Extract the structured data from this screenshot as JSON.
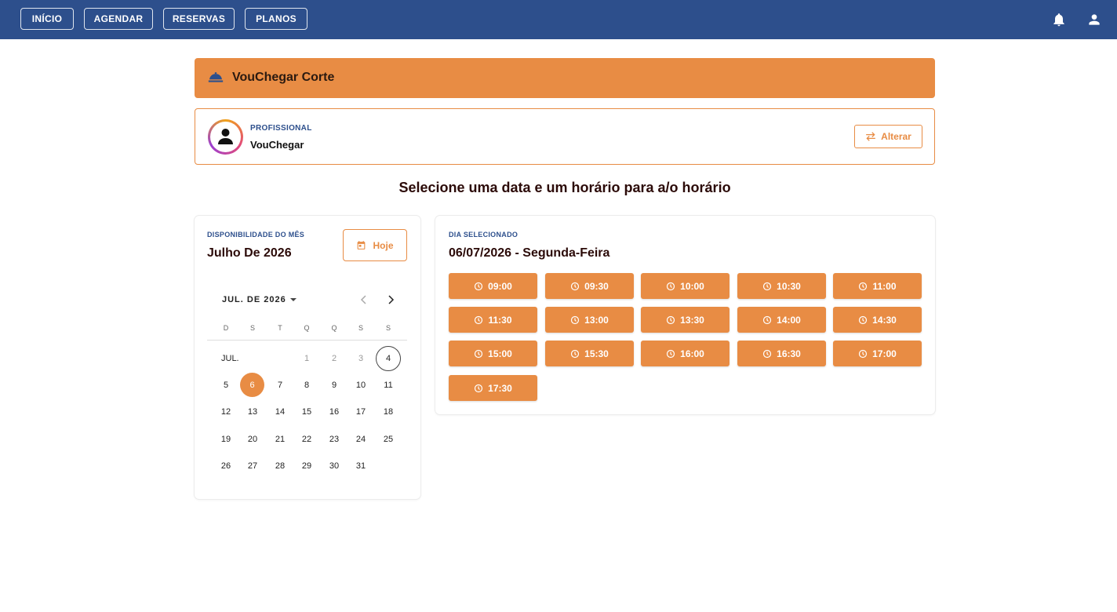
{
  "nav": {
    "items": [
      {
        "label": "INÍCIO"
      },
      {
        "label": "AGENDAR"
      },
      {
        "label": "RESERVAS"
      },
      {
        "label": "PLANOS"
      }
    ],
    "icons": [
      "bell-icon",
      "account-icon"
    ]
  },
  "service": {
    "title": "VouChegar Corte",
    "icon": "service-bell-icon"
  },
  "professional": {
    "label": "PROFISSIONAL",
    "name": "VouChegar",
    "change_label": "Alterar",
    "change_icon": "swap-icon"
  },
  "heading": "Selecione uma data e um horário para a/o horário",
  "calendar": {
    "label": "DISPONIBILIDADE DO MÊS",
    "title": "Julho De 2026",
    "today_label": "Hoje",
    "month_select": "JUL. DE 2026",
    "month_abbr": "JUL.",
    "weekdays": [
      "D",
      "S",
      "T",
      "Q",
      "Q",
      "S",
      "S"
    ],
    "days": {
      "disabled": [
        "1",
        "2",
        "3"
      ],
      "today": "4",
      "selected": "6",
      "all": [
        "1",
        "2",
        "3",
        "4",
        "5",
        "6",
        "7",
        "8",
        "9",
        "10",
        "11",
        "12",
        "13",
        "14",
        "15",
        "16",
        "17",
        "18",
        "19",
        "20",
        "21",
        "22",
        "23",
        "24",
        "25",
        "26",
        "27",
        "28",
        "29",
        "30",
        "31"
      ]
    }
  },
  "times": {
    "label": "DIA SELECIONADO",
    "date": "06/07/2026 - Segunda-Feira",
    "slots": [
      "09:00",
      "09:30",
      "10:00",
      "10:30",
      "11:00",
      "11:30",
      "13:00",
      "13:30",
      "14:00",
      "14:30",
      "15:00",
      "15:30",
      "16:00",
      "16:30",
      "17:00",
      "17:30"
    ]
  },
  "colors": {
    "primary": "#2d4f8c",
    "accent": "#e88c44",
    "heading": "#2b0a08"
  }
}
